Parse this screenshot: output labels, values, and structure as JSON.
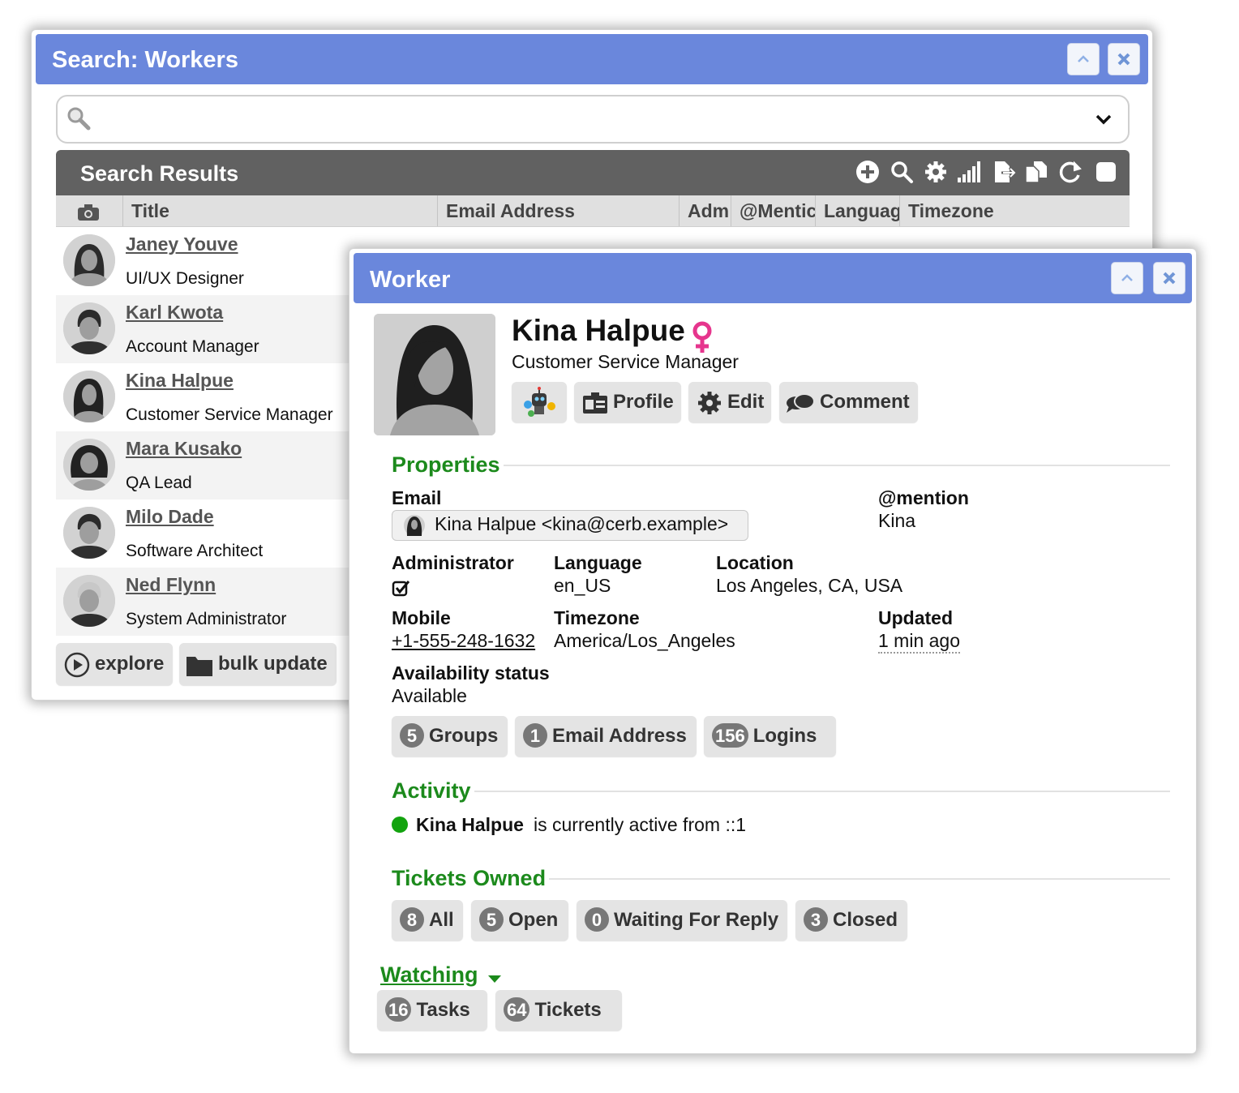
{
  "search_window": {
    "title": "Search: Workers",
    "search": {
      "value": "",
      "placeholder": ""
    },
    "results": {
      "title": "Search Results",
      "columns": [
        "Title",
        "Email Address",
        "Adm",
        "@Mentic",
        "Languag",
        "Timezone"
      ],
      "rows": [
        {
          "name": "Janey Youve",
          "title": "UI/UX Designer"
        },
        {
          "name": "Karl Kwota",
          "title": "Account Manager"
        },
        {
          "name": "Kina Halpue",
          "title": "Customer Service Manager"
        },
        {
          "name": "Mara Kusako",
          "title": "QA Lead"
        },
        {
          "name": "Milo Dade",
          "title": "Software Architect"
        },
        {
          "name": "Ned Flynn",
          "title": "System Administrator"
        }
      ]
    },
    "buttons": {
      "explore": "explore",
      "bulk_update": "bulk update"
    }
  },
  "worker_window": {
    "title": "Worker",
    "name": "Kina Halpue",
    "job_title": "Customer Service Manager",
    "gender_icon": "female-icon",
    "actions": {
      "profile": "Profile",
      "edit": "Edit",
      "comment": "Comment"
    },
    "properties": {
      "heading": "Properties",
      "email_label": "Email",
      "email_value": "Kina Halpue <kina@cerb.example>",
      "mention_label": "@mention",
      "mention_value": "Kina",
      "admin_label": "Administrator",
      "language_label": "Language",
      "language_value": "en_US",
      "location_label": "Location",
      "location_value": "Los Angeles, CA, USA",
      "mobile_label": "Mobile",
      "mobile_value": "+1-555-248-1632",
      "timezone_label": "Timezone",
      "timezone_value": "America/Los_Angeles",
      "updated_label": "Updated",
      "updated_value": "1 min ago",
      "availability_label": "Availability status",
      "availability_value": "Available"
    },
    "links": [
      {
        "count": "5",
        "label": "Groups"
      },
      {
        "count": "1",
        "label": "Email Address"
      },
      {
        "count": "156",
        "label": "Logins"
      }
    ],
    "activity": {
      "heading": "Activity",
      "name": "Kina Halpue",
      "text": "is currently active from ::1",
      "status_color": "#13a30f"
    },
    "tickets": {
      "heading": "Tickets Owned",
      "items": [
        {
          "count": "8",
          "label": "All"
        },
        {
          "count": "5",
          "label": "Open"
        },
        {
          "count": "0",
          "label": "Waiting For Reply"
        },
        {
          "count": "3",
          "label": "Closed"
        }
      ]
    },
    "watching": {
      "heading": "Watching",
      "items": [
        {
          "count": "16",
          "label": "Tasks"
        },
        {
          "count": "64",
          "label": "Tickets"
        }
      ]
    }
  },
  "colors": {
    "titlebar": "#6a87dc",
    "section_heading": "#1c8a1c",
    "female": "#e6358d"
  }
}
